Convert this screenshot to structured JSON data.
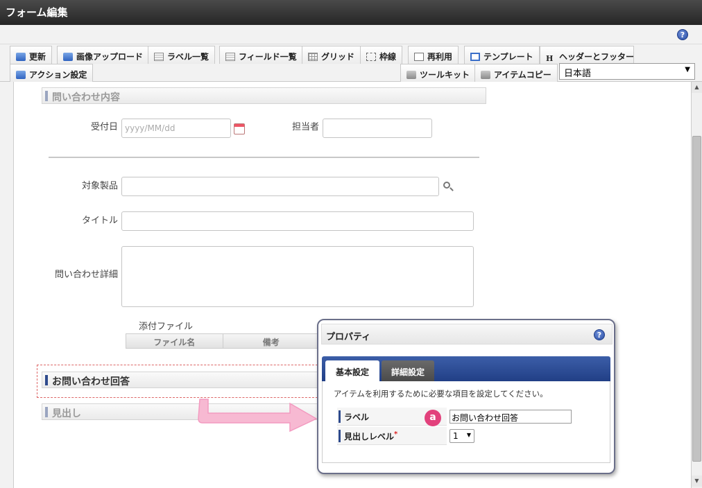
{
  "window": {
    "title": "フォーム編集"
  },
  "toolbar": {
    "row1": [
      "更新",
      "画像アップロード",
      "ラベル一覧",
      "フィールド一覧",
      "グリッド",
      "枠線",
      "再利用",
      "テンプレート",
      "ヘッダーとフッター"
    ],
    "action": "アクション設定",
    "toolkit": "ツールキット",
    "item_copy": "アイテムコピー",
    "language": "日本語"
  },
  "form": {
    "section1": "問い合わせ内容",
    "reception_label": "受付日",
    "reception_placeholder": "yyyy/MM/dd",
    "assignee_label": "担当者",
    "product_label": "対象製品",
    "title_label": "タイトル",
    "detail_label": "問い合わせ詳細",
    "attach_label": "添付ファイル",
    "attach_cols": [
      "ファイル名",
      "備考"
    ],
    "section2": "お問い合わせ回答",
    "section3": "見出し"
  },
  "property": {
    "title": "プロパティ",
    "tab_basic": "基本設定",
    "tab_detail": "詳細設定",
    "description": "アイテムを利用するために必要な項目を設定してください。",
    "label_name": "ラベル",
    "label_value": "お問い合わせ回答",
    "level_name": "見出しレベル",
    "level_value": "1",
    "required_mark": "*"
  },
  "annotation": {
    "badge": "a"
  },
  "colors": {
    "accent": "#2f4b8d",
    "badge": "#e2417c",
    "arrow": "#f39ac0"
  }
}
